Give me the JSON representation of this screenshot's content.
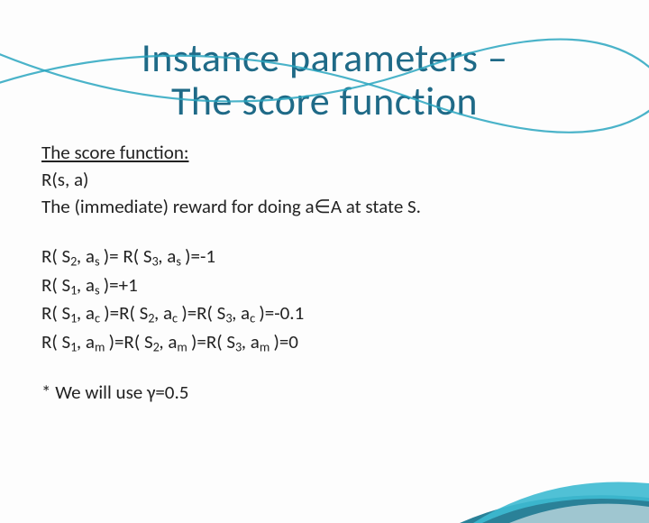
{
  "title_line1": "Instance parameters –",
  "title_line2": "The score function",
  "heading": "The score function:",
  "def1": "R(s, a)",
  "def2_pre": "The (immediate) reward for doing a",
  "def2_sym": "∈",
  "def2_post": "A at state S.",
  "eq1": {
    "a": "R( S",
    "s1": "2",
    "b": ", a",
    "s2": "s",
    "c": " )= R( S",
    "s3": "3",
    "d": ", a",
    "s4": "s",
    "e": " )=-1"
  },
  "eq2": {
    "a": "R( S",
    "s1": "1",
    "b": ", a",
    "s2": "s",
    "c": " )=+1"
  },
  "eq3": {
    "a": "R( S",
    "s1": "1",
    "b": ", a",
    "s2": "c",
    "c": " )=R( S",
    "s3": "2",
    "d": ", a",
    "s4": "c",
    "e": " )=R( S",
    "s5": "3",
    "f": ", a",
    "s6": "c",
    "g": " )=-0.1"
  },
  "eq4": {
    "a": "R( S",
    "s1": "1",
    "b": ", a",
    "s2": "m",
    "c": " )=R( S",
    "s3": "2",
    "d": ", a",
    "s4": "m",
    "e": " )=R( S",
    "s5": "3",
    "f": ", a",
    "s6": "m",
    "g": " )=0"
  },
  "note": "* We will use γ=0.5"
}
